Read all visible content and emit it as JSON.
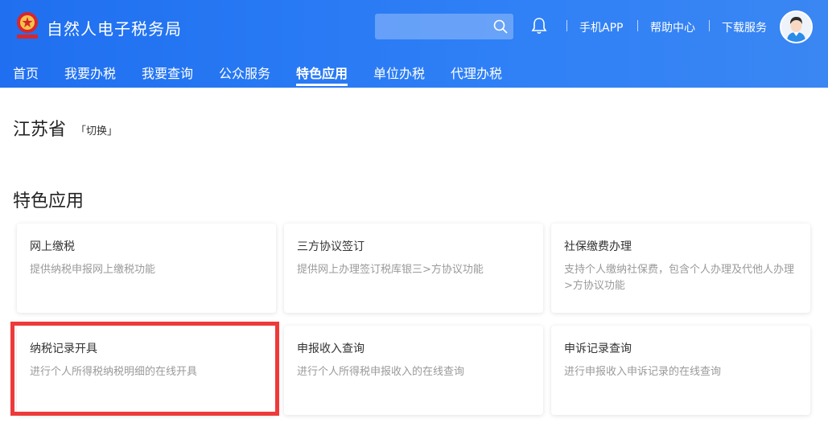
{
  "header": {
    "brand": "自然人电子税务局",
    "search": {
      "placeholder": ""
    },
    "links": [
      "手机APP",
      "帮助中心",
      "下载服务"
    ],
    "icons": {
      "search": "search-icon",
      "notify": "bell-icon",
      "user": "avatar"
    }
  },
  "nav": {
    "items": [
      "首页",
      "我要办税",
      "我要查询",
      "公众服务",
      "特色应用",
      "单位办税",
      "代理办税"
    ],
    "active": "特色应用"
  },
  "region": {
    "province": "江苏省",
    "switch_label": "「切换」"
  },
  "section": {
    "title": "特色应用"
  },
  "cards": [
    {
      "title": "网上缴税",
      "desc": "提供纳税申报网上缴税功能"
    },
    {
      "title": "三方协议签订",
      "desc": "提供网上办理签订税库银三>方协议功能"
    },
    {
      "title": "社保缴费办理",
      "desc": "支持个人缴纳社保费，包含个人办理及代他人办理>方协议功能"
    },
    {
      "title": "纳税记录开具",
      "desc": "进行个人所得税纳税明细的在线开具"
    },
    {
      "title": "申报收入查询",
      "desc": "进行个人所得税申报收入的在线查询"
    },
    {
      "title": "申诉记录查询",
      "desc": "进行申报收入申诉记录的在线查询"
    }
  ],
  "colors": {
    "header_blue": "#2f80f6",
    "highlight_red": "#ee3a3a"
  }
}
